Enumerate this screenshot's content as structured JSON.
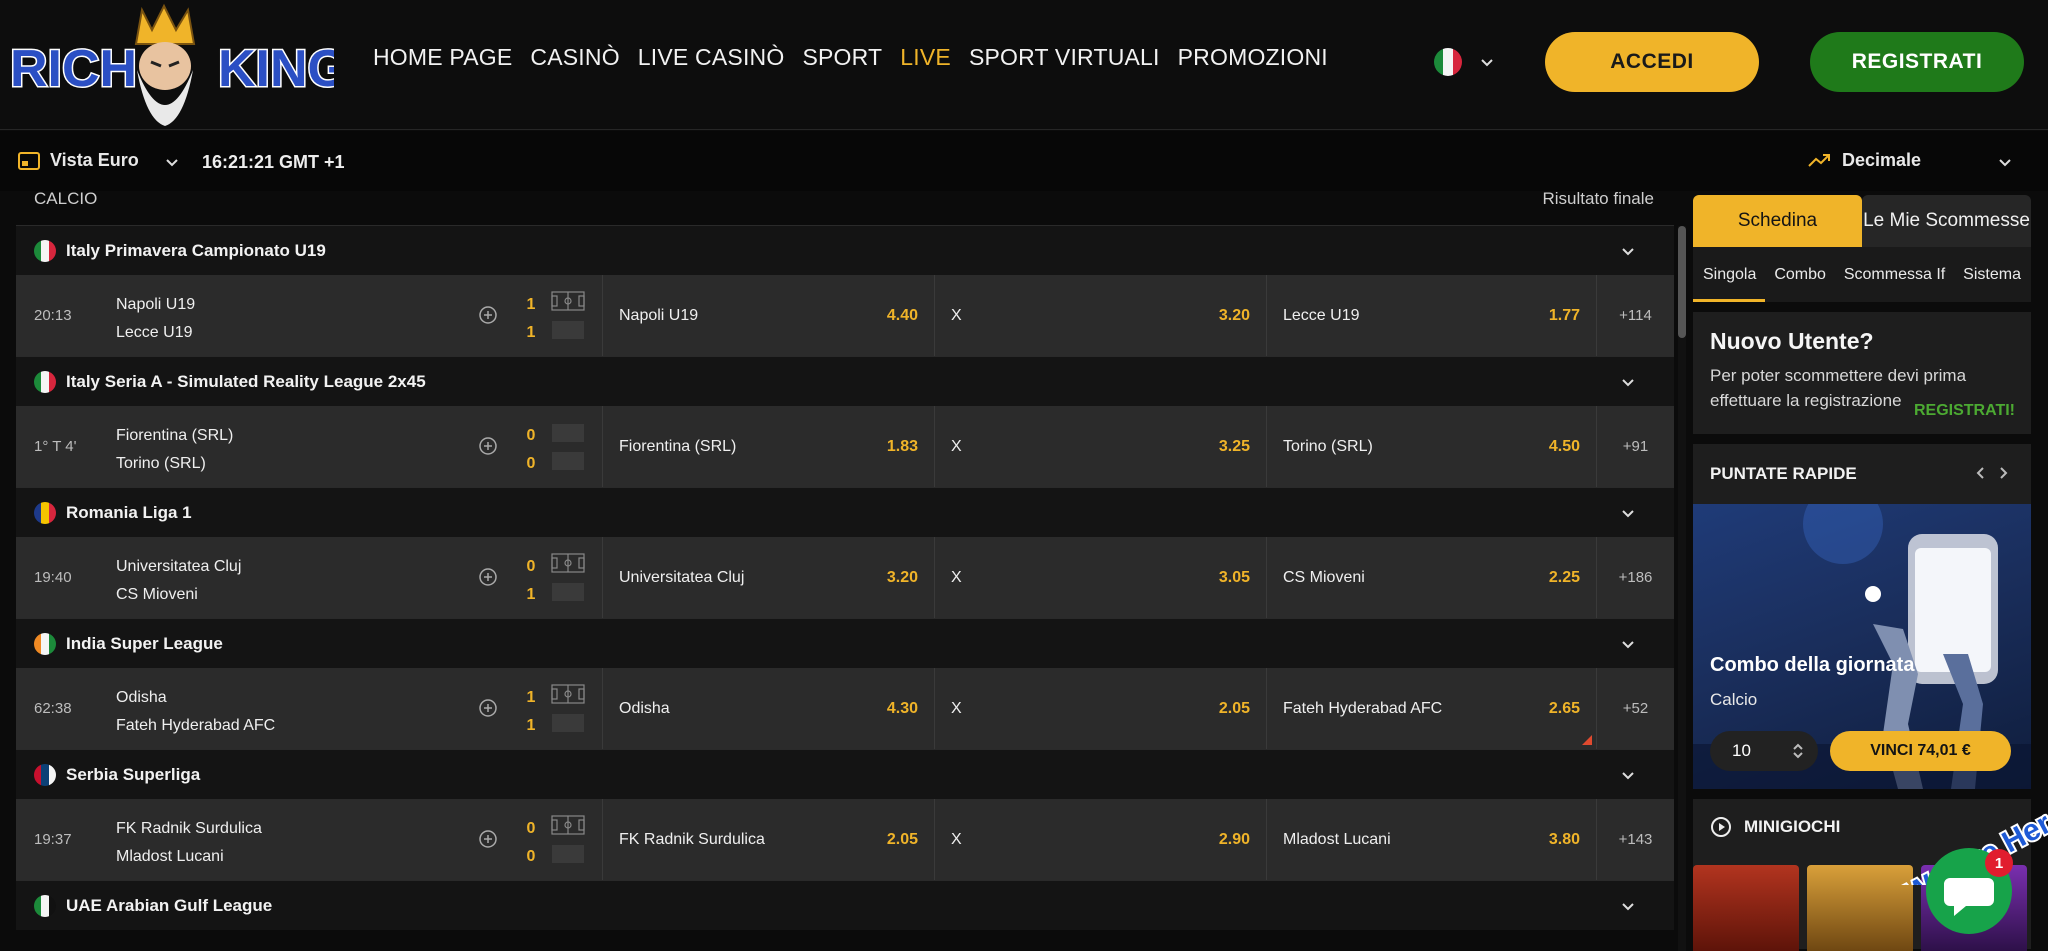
{
  "header": {
    "logo_text": "RICH KING",
    "nav": [
      "HOME PAGE",
      "CASINÒ",
      "LIVE CASINÒ",
      "SPORT",
      "LIVE",
      "SPORT VIRTUALI",
      "PROMOZIONI"
    ],
    "active_nav": "LIVE",
    "login_label": "ACCEDI",
    "register_label": "REGISTRATI"
  },
  "subbar": {
    "view_label": "Vista Euro",
    "time": "16:21:21 GMT +1",
    "odds_format": "Decimale"
  },
  "main": {
    "sport": "CALCIO",
    "market": "Risultato finale",
    "leagues": [
      {
        "name": "Italy Primavera Campionato U19",
        "flag": [
          "#1c8a3a",
          "#f5f5f5",
          "#d7263d"
        ],
        "match": {
          "time": "20:13",
          "home": "Napoli U19",
          "away": "Lecce U19",
          "score_home": "1",
          "score_away": "1",
          "odd1": "4.40",
          "oddx": "3.20",
          "odd2": "1.77",
          "x_label": "X",
          "more": "+114"
        }
      },
      {
        "name": "Italy Seria A - Simulated Reality League 2x45",
        "flag": [
          "#1c8a3a",
          "#f5f5f5",
          "#d7263d"
        ],
        "match": {
          "time": "1° T 4'",
          "home": "Fiorentina (SRL)",
          "away": "Torino (SRL)",
          "score_home": "0",
          "score_away": "0",
          "odd1": "1.83",
          "oddx": "3.25",
          "odd2": "4.50",
          "x_label": "X",
          "more": "+91"
        }
      },
      {
        "name": "Romania Liga 1",
        "flag": [
          "#1e3a8a",
          "#f5c400",
          "#d7263d"
        ],
        "match": {
          "time": "19:40",
          "home": "Universitatea Cluj",
          "away": "CS Mioveni",
          "score_home": "0",
          "score_away": "1",
          "odd1": "3.20",
          "oddx": "3.05",
          "odd2": "2.25",
          "x_label": "X",
          "more": "+186"
        }
      },
      {
        "name": "India Super League",
        "flag": [
          "#f08a24",
          "#f5f5f5",
          "#1c8a3a"
        ],
        "match": {
          "time": "62:38",
          "home": "Odisha",
          "away": "Fateh Hyderabad AFC",
          "score_home": "1",
          "score_away": "1",
          "odd1": "4.30",
          "oddx": "2.05",
          "odd2": "2.65",
          "x_label": "X",
          "more": "+52"
        }
      },
      {
        "name": "Serbia Superliga",
        "flag": [
          "#c8102e",
          "#0c4076",
          "#f5f5f5"
        ],
        "match": {
          "time": "19:37",
          "home": "FK Radnik Surdulica",
          "away": "Mladost Lucani",
          "score_home": "0",
          "score_away": "0",
          "odd1": "2.05",
          "oddx": "2.90",
          "odd2": "3.80",
          "x_label": "X",
          "more": "+143"
        }
      },
      {
        "name": "UAE Arabian Gulf League",
        "flag": [
          "#1c8a3a",
          "#f5f5f5",
          "#111111"
        ],
        "match": null
      }
    ]
  },
  "betslip": {
    "tab_active": "Schedina",
    "tab_other": "Le Mie Scommesse",
    "sub_tabs": [
      "Singola",
      "Combo",
      "Scommessa If",
      "Sistema"
    ],
    "new_user_title": "Nuovo Utente?",
    "new_user_text": "Per poter scommettere devi prima effettuare la registrazione",
    "new_user_link": "REGISTRATI!"
  },
  "quick_bets": {
    "title": "PUNTATE RAPIDE",
    "card_title": "Combo della giornata",
    "card_sub": "Calcio",
    "stake": "10",
    "win_label": "VINCI 74,01 €"
  },
  "mini_games": {
    "title": "MINIGIOCHI"
  },
  "chat": {
    "badge": "1",
    "tagline": "We Are Here!"
  },
  "colors": {
    "accent": "#f0b429",
    "register_green": "#1f7a1a",
    "row_bg": "#2b2b2b"
  }
}
